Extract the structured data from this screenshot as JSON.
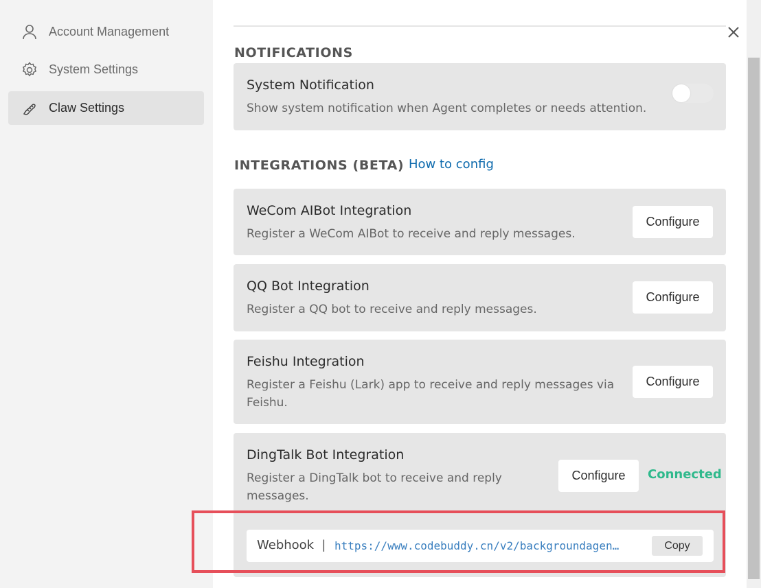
{
  "sidebar": {
    "items": [
      {
        "label": "Account Management",
        "icon": "user-icon"
      },
      {
        "label": "System Settings",
        "icon": "gear-icon"
      },
      {
        "label": "Claw Settings",
        "icon": "claw-icon",
        "active": true
      }
    ]
  },
  "notifications": {
    "section_title": "NOTIFICATIONS",
    "system": {
      "title": "System Notification",
      "description": "Show system notification when Agent completes or needs attention.",
      "enabled": false
    }
  },
  "integrations": {
    "section_title": "INTEGRATIONS (BETA)",
    "help_link": "How to config",
    "wecom": {
      "title": "WeCom AIBot Integration",
      "description": "Register a WeCom AIBot to receive and reply messages.",
      "button": "Configure"
    },
    "qq": {
      "title": "QQ Bot Integration",
      "description": "Register a QQ bot to receive and reply messages.",
      "button": "Configure"
    },
    "feishu": {
      "title": "Feishu Integration",
      "description": "Register a Feishu (Lark) app to receive and reply messages via Feishu.",
      "button": "Configure"
    },
    "dingtalk": {
      "title": "DingTalk Bot Integration",
      "description": "Register a DingTalk bot to receive and reply messages.",
      "button": "Configure",
      "status": "Connected",
      "webhook": {
        "label": "Webhook",
        "separator": "|",
        "url": "https://www.codebuddy.cn/v2/backgroundagen…",
        "copy": "Copy"
      }
    }
  },
  "colors": {
    "connected": "#2fb98c",
    "link": "#0d6aad",
    "highlight": "#e64f5a"
  }
}
